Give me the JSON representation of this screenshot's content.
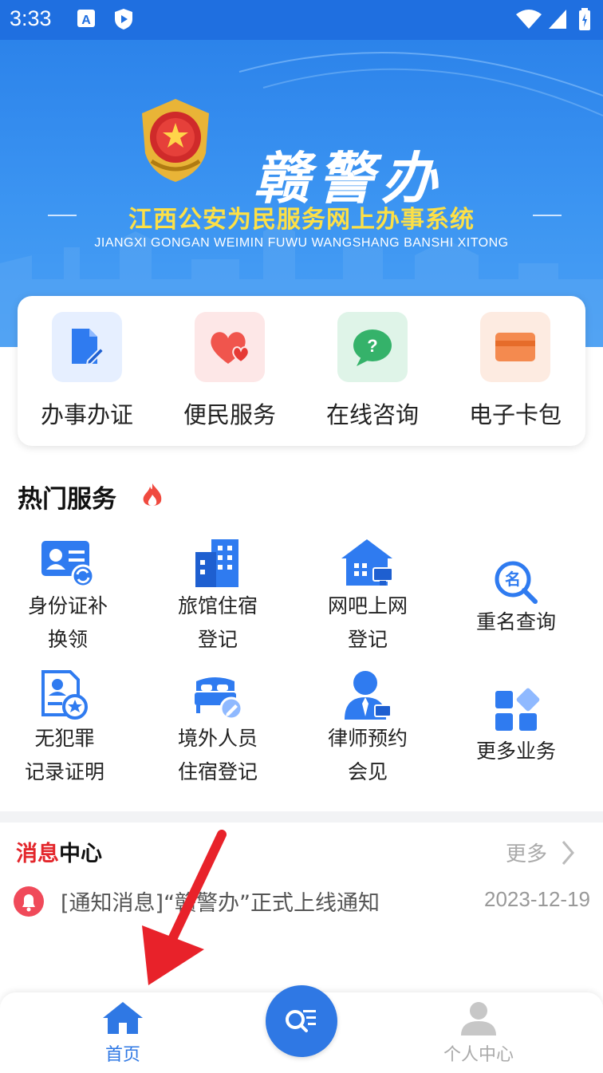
{
  "status_bar": {
    "time": "3:33"
  },
  "banner": {
    "title": "赣警办",
    "subtitle": "江西公安为民服务网上办事系统",
    "pinyin": "JIANGXI GONGAN WEIMIN FUWU WANGSHANG BANSHI XITONG"
  },
  "quick_actions": [
    {
      "label": "办事办证",
      "icon": "document-edit-icon",
      "bg": "#e6efff",
      "color": "#2f7bf0"
    },
    {
      "label": "便民服务",
      "icon": "hearts-icon",
      "bg": "#fde7e7",
      "color": "#f0554d"
    },
    {
      "label": "在线咨询",
      "icon": "chat-question-icon",
      "bg": "#dff4e8",
      "color": "#35b26a"
    },
    {
      "label": "电子卡包",
      "icon": "card-wallet-icon",
      "bg": "#fdebe1",
      "color": "#f48a4f"
    }
  ],
  "hot_services": {
    "title": "热门服务",
    "items": [
      {
        "line1": "身份证补",
        "line2": "换领",
        "icon": "id-card-refresh-icon"
      },
      {
        "line1": "旅馆住宿",
        "line2": "登记",
        "icon": "hotel-building-icon"
      },
      {
        "line1": "网吧上网",
        "line2": "登记",
        "icon": "internet-cafe-icon"
      },
      {
        "line1": "重名查询",
        "line2": "",
        "icon": "name-search-icon"
      },
      {
        "line1": "无犯罪",
        "line2": "记录证明",
        "icon": "certificate-star-icon"
      },
      {
        "line1": "境外人员",
        "line2": "住宿登记",
        "icon": "bed-edit-icon"
      },
      {
        "line1": "律师预约",
        "line2": "会见",
        "icon": "lawyer-icon"
      },
      {
        "line1": "更多业务",
        "line2": "",
        "icon": "more-grid-icon"
      }
    ]
  },
  "messages": {
    "title_part1": "消息",
    "title_part2": "中心",
    "more": "更多",
    "items": [
      {
        "text": "[通知消息]“赣警办”正式上线通知",
        "date": "2023-12-19"
      }
    ]
  },
  "bottom_nav": {
    "home": "首页",
    "profile": "个人中心"
  },
  "colors": {
    "brand": "#2f78e4",
    "accent": "#e3262b",
    "icon_blue": "#2f7bf0"
  }
}
